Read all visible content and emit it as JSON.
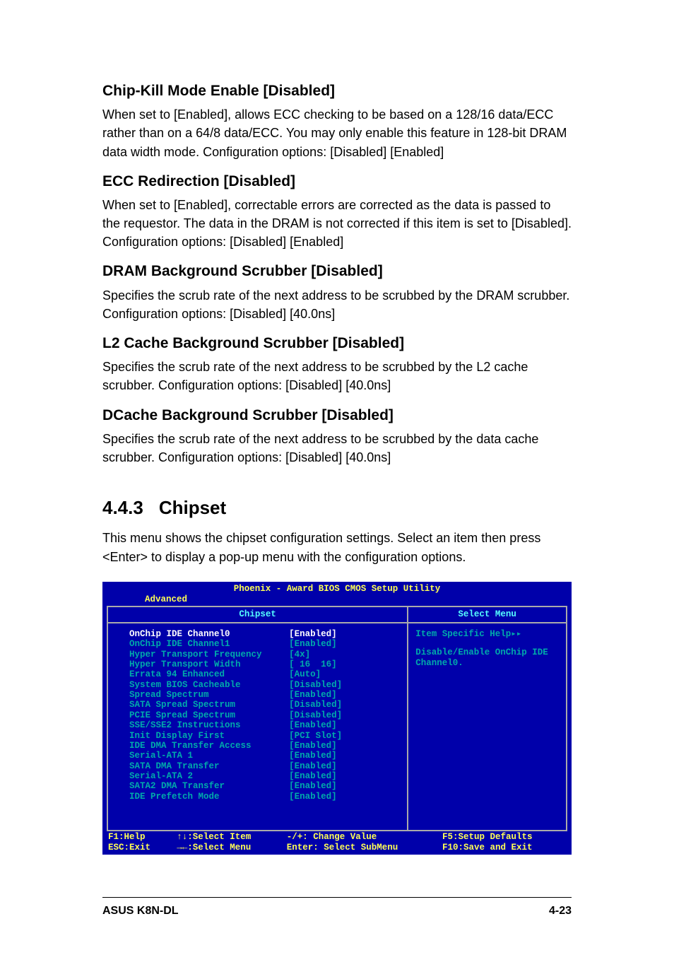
{
  "sections": [
    {
      "heading": "Chip-Kill Mode Enable [Disabled]",
      "body": "When set to [Enabled], allows ECC checking to be based on a 128/16 data/ECC rather than on a 64/8 data/ECC. You may only enable this feature in 128-bit DRAM data width mode. Configuration options: [Disabled] [Enabled]"
    },
    {
      "heading": "ECC Redirection [Disabled]",
      "body": "When set to [Enabled], correctable errors are corrected as the data is passed to the requestor. The data in the DRAM is not corrected if this item is set to [Disabled]. Configuration options: [Disabled] [Enabled]"
    },
    {
      "heading": "DRAM Background Scrubber [Disabled]",
      "body": "Specifies the scrub rate of the next address to be scrubbed by the DRAM scrubber. Configuration options: [Disabled] [40.0ns]"
    },
    {
      "heading": "L2 Cache Background Scrubber [Disabled]",
      "body": "Specifies the scrub rate of the next address to be scrubbed by the L2 cache scrubber. Configuration options: [Disabled] [40.0ns]"
    },
    {
      "heading": "DCache Background Scrubber [Disabled]",
      "body": "Specifies the scrub rate of the next address to be scrubbed by the data cache scrubber. Configuration options: [Disabled] [40.0ns]"
    }
  ],
  "chipset": {
    "number": "4.4.3",
    "title": "Chipset",
    "intro": "This menu shows the chipset configuration settings. Select an item then press <Enter> to display a pop-up menu with the configuration options."
  },
  "bios": {
    "title": "Phoenix - Award BIOS CMOS Setup Utility",
    "tab": "Advanced",
    "panel_left_header": "Chipset",
    "panel_right_header": "Select Menu",
    "rows": [
      {
        "label": "OnChip IDE Channel0",
        "value": "[Enabled]",
        "hl": true
      },
      {
        "label": "OnChip IDE Channel1",
        "value": "[Enabled]",
        "hl": false
      },
      {
        "label": "Hyper Transport Frequency",
        "value": "[4x]",
        "hl": false
      },
      {
        "label": "Hyper Transport Width",
        "value": "[ 16  16]",
        "hl": false
      },
      {
        "label": "Errata 94 Enhanced",
        "value": "[Auto]",
        "hl": false
      },
      {
        "label": "System BIOS Cacheable",
        "value": "[Disabled]",
        "hl": false
      },
      {
        "label": "Spread Spectrum",
        "value": "[Enabled]",
        "hl": false
      },
      {
        "label": "SATA Spread Spectrum",
        "value": "[Disabled]",
        "hl": false
      },
      {
        "label": "PCIE Spread Spectrum",
        "value": "[Disabled]",
        "hl": false
      },
      {
        "label": "SSE/SSE2 Instructions",
        "value": "[Enabled]",
        "hl": false
      },
      {
        "label": "Init Display First",
        "value": "[PCI Slot]",
        "hl": false
      },
      {
        "label": "IDE DMA Transfer Access",
        "value": "[Enabled]",
        "hl": false
      },
      {
        "label": "Serial-ATA 1",
        "value": "[Enabled]",
        "hl": false
      },
      {
        "label": "SATA DMA Transfer",
        "value": "[Enabled]",
        "hl": false
      },
      {
        "label": "Serial-ATA 2",
        "value": "[Enabled]",
        "hl": false
      },
      {
        "label": "SATA2 DMA Transfer",
        "value": "[Enabled]",
        "hl": false
      },
      {
        "label": "IDE Prefetch Mode",
        "value": "[Enabled]",
        "hl": false
      }
    ],
    "help_title": "Item Specific Help▸▸",
    "help_body": "Disable/Enable OnChip IDE Channel0.",
    "footer": {
      "f1": "F1:Help",
      "sel_item": "↑↓:Select Item",
      "change": "-/+: Change Value",
      "defaults": "F5:Setup Defaults",
      "esc": "ESC:Exit",
      "sel_menu": "→←:Select Menu",
      "enter": "Enter: Select SubMenu",
      "save": "F10:Save and Exit"
    }
  },
  "page_footer": {
    "left": "ASUS K8N-DL",
    "right": "4-23"
  }
}
